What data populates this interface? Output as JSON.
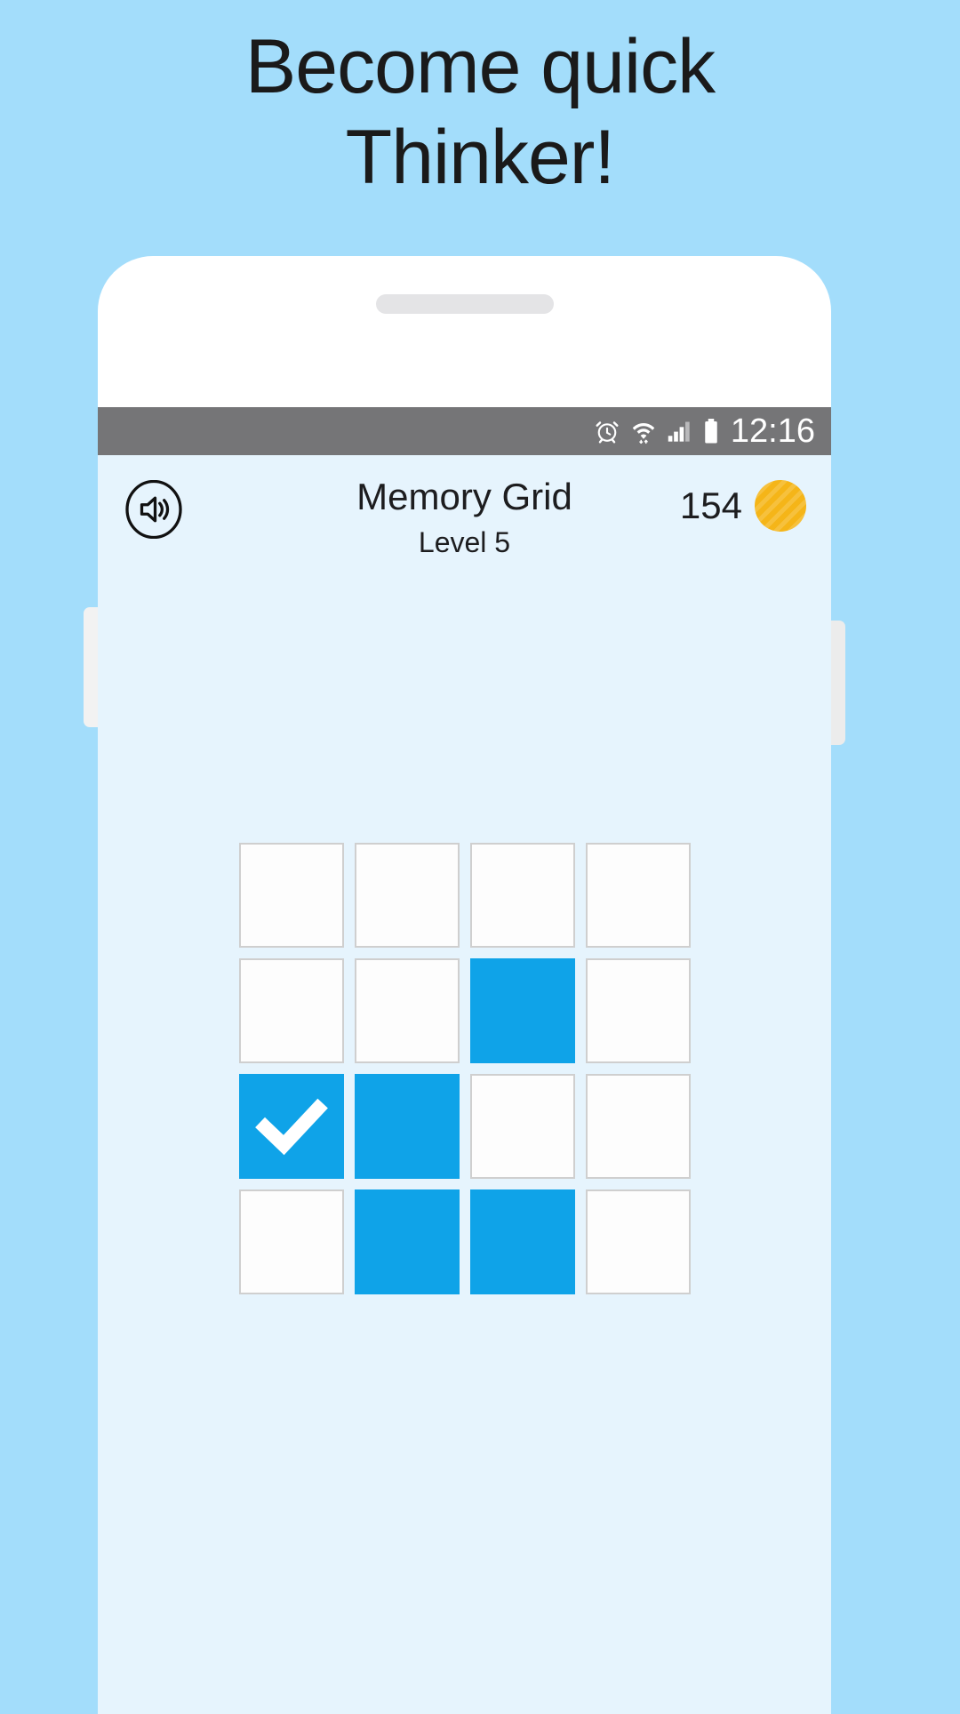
{
  "promo": {
    "headline_line1": "Become quick",
    "headline_line2": "Thinker!",
    "background_color": "#a3ddfb",
    "text_color": "#1a1a1a"
  },
  "device": {
    "body_color": "#ffffff",
    "earpiece": "earpiece-speaker",
    "side_button_left": "volume-button",
    "side_button_right": "power-button"
  },
  "statusbar": {
    "background_color": "#757577",
    "time": "12:16",
    "icons": [
      {
        "name": "alarm-icon",
        "label": "alarm"
      },
      {
        "name": "wifi-icon",
        "label": "wifi"
      },
      {
        "name": "signal-icon",
        "label": "cellular signal",
        "bars_filled": 3,
        "bars_total": 4
      },
      {
        "name": "battery-icon",
        "label": "battery",
        "level": "full"
      }
    ]
  },
  "app": {
    "background_color": "#e6f4fd",
    "sound_button": "sound-on",
    "title": "Memory Grid",
    "subtitle": "Level 5",
    "coins": "154",
    "coin_color": "#f5b518"
  },
  "grid": {
    "rows": 4,
    "columns": 4,
    "active_color": "#0fa3e8",
    "inactive_color": "#fdfdfd",
    "border_color": "#cfcfcf",
    "cells": [
      {
        "row": 1,
        "col": 1,
        "state": "off",
        "check": false
      },
      {
        "row": 1,
        "col": 2,
        "state": "off",
        "check": false
      },
      {
        "row": 1,
        "col": 3,
        "state": "off",
        "check": false
      },
      {
        "row": 1,
        "col": 4,
        "state": "off",
        "check": false
      },
      {
        "row": 2,
        "col": 1,
        "state": "off",
        "check": false
      },
      {
        "row": 2,
        "col": 2,
        "state": "off",
        "check": false
      },
      {
        "row": 2,
        "col": 3,
        "state": "on",
        "check": false
      },
      {
        "row": 2,
        "col": 4,
        "state": "off",
        "check": false
      },
      {
        "row": 3,
        "col": 1,
        "state": "on",
        "check": true
      },
      {
        "row": 3,
        "col": 2,
        "state": "on",
        "check": false
      },
      {
        "row": 3,
        "col": 3,
        "state": "off",
        "check": false
      },
      {
        "row": 3,
        "col": 4,
        "state": "off",
        "check": false
      },
      {
        "row": 4,
        "col": 1,
        "state": "off",
        "check": false
      },
      {
        "row": 4,
        "col": 2,
        "state": "on",
        "check": false
      },
      {
        "row": 4,
        "col": 3,
        "state": "on",
        "check": false
      },
      {
        "row": 4,
        "col": 4,
        "state": "off",
        "check": false
      }
    ]
  }
}
